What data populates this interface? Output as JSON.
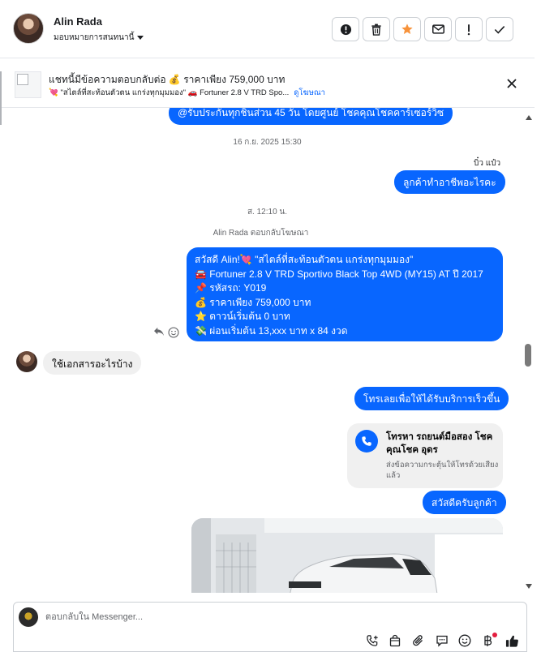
{
  "header": {
    "contact_name": "Alin Rada",
    "assign_label": "มอบหมายการสนทนานี้",
    "buttons": [
      {
        "name": "report-spam-button",
        "icon": "alert-circle-icon"
      },
      {
        "name": "delete-button",
        "icon": "trash-icon"
      },
      {
        "name": "star-button",
        "icon": "star-icon"
      },
      {
        "name": "mark-unread-button",
        "icon": "envelope-icon"
      },
      {
        "name": "follow-up-button",
        "icon": "exclamation-icon"
      },
      {
        "name": "mark-done-button",
        "icon": "check-icon"
      }
    ],
    "star_color": "#f7923a"
  },
  "ad_context": {
    "title": "แชทนี้มีข้อความตอบกลับต่อ 💰 ราคาเพียง 759,000 บาท",
    "subtitle": "💘 \"สไตล์ที่สะท้อนตัวตน แกร่งทุกมุมมอง\" 🚗 Fortuner 2.8 V TRD Spo...",
    "link": "ดูโฆษณา"
  },
  "messages": {
    "clipped_top": "@รับประกันทุกชิ้นส่วน 45 วัน โดยศูนย์ โชคคุณโชคคาร์เซอร์วิซ",
    "timestamp1": "16 ก.ย. 2025 15:30",
    "sender_out": "บิ๋ว แป๋ว",
    "out1": "ลูกค้าทำอาชีพอะไรคะ",
    "timestamp2": "ส. 12:10 น.",
    "reply_notice": "Alin Rada ตอบกลับโฆษณา",
    "ad_reply_lines": [
      "สวัสดี Alin!💘 \"สไตล์ที่สะท้อนตัวตน แกร่งทุกมุมมอง\"",
      "🚘  Fortuner 2.8 V TRD Sportivo Black Top 4WD (MY15) AT ปี 2017",
      "📌 รหัสรถ: Y019",
      "💰 ราคาเพียง 759,000 บาท",
      "⭐ ดาวน์เริ่มต้น 0 บาท",
      "💸 ผ่อนเริ่มต้น 13,xxx บาท x 84 งวด"
    ],
    "in1": "ใช้เอกสารอะไรบ้าง",
    "out2": "โทรเลยเพื่อให้ได้รับบริการเร็วขึ้น",
    "call_card": {
      "title": "โทรหา รถยนต์มือสอง โชคคุณโชค อุดร",
      "subtitle": "ส่งข้อความกระตุ้นให้โทรด้วยเสียงแล้ว"
    },
    "out3": "สวัสดีครับลูกค้า"
  },
  "composer": {
    "placeholder": "ตอบกลับใน Messenger..."
  },
  "colors": {
    "accent": "#0866ff",
    "incoming_bg": "#f0f0f0"
  }
}
